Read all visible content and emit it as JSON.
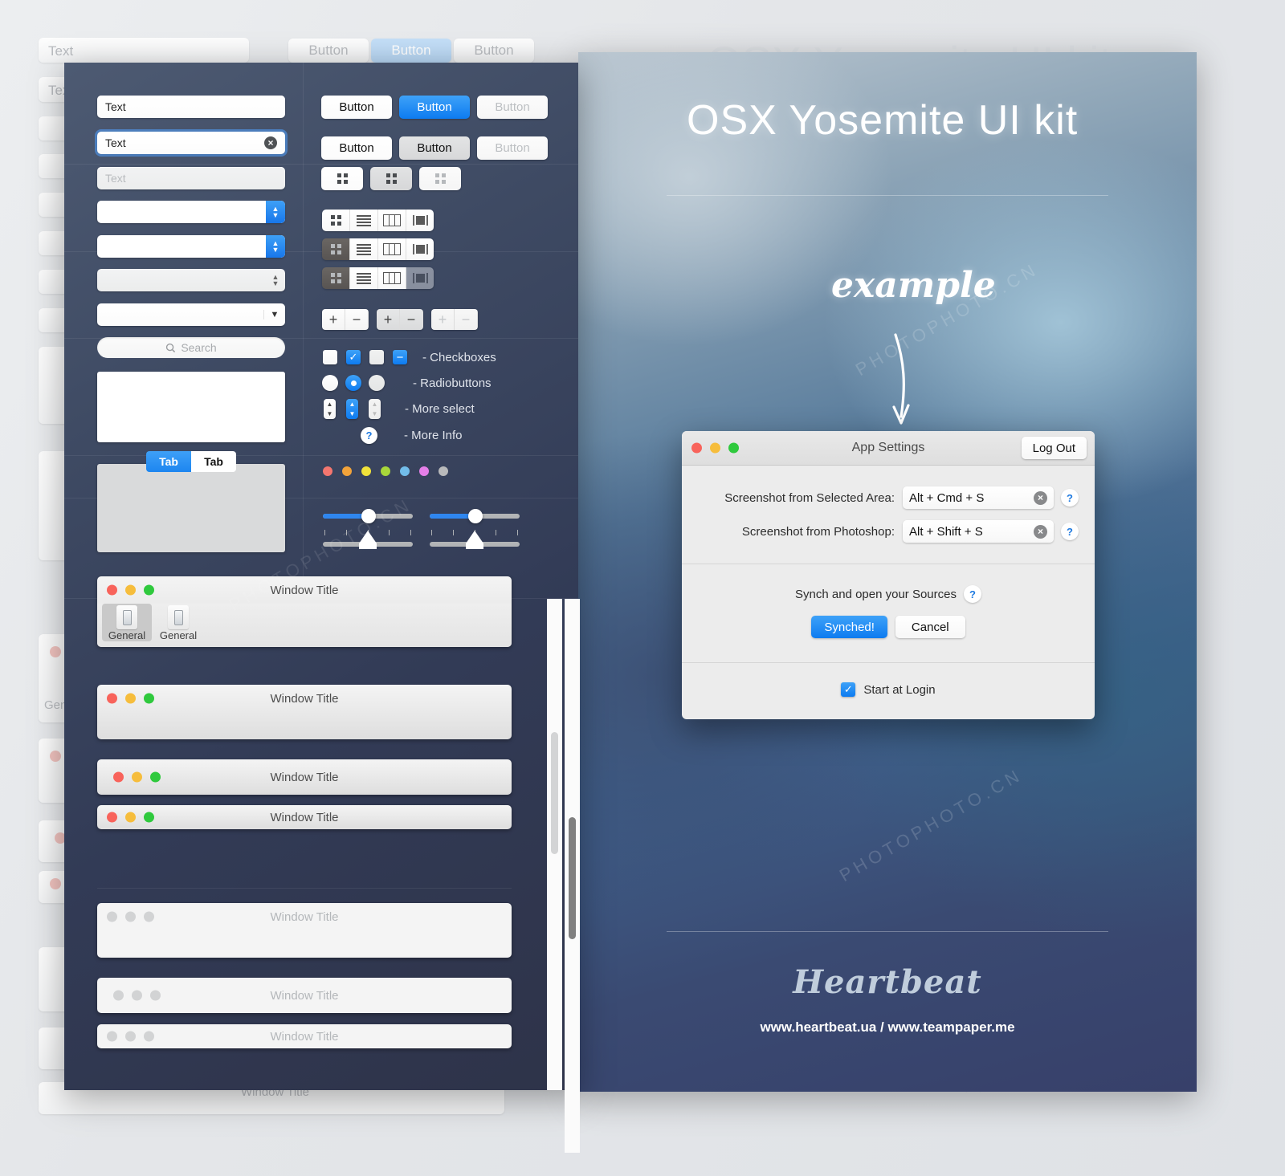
{
  "background": {
    "ghost_text_field": "Text",
    "ghost_buttons": [
      "Button",
      "Button",
      "Button"
    ]
  },
  "kit": {
    "left_column": {
      "text_field_default": "Text",
      "text_field_focused": "Text",
      "text_field_focused_clear_icon": "clear-icon",
      "text_field_disabled": "Text",
      "search_placeholder": "Search",
      "search_icon": "search-icon",
      "tabs": [
        {
          "label": "Tab",
          "state": "active"
        },
        {
          "label": "Tab",
          "state": "inactive"
        }
      ]
    },
    "right_column": {
      "buttons_row1": [
        {
          "label": "Button",
          "state": "default"
        },
        {
          "label": "Button",
          "state": "primary"
        },
        {
          "label": "Button",
          "state": "disabled"
        }
      ],
      "buttons_row2": [
        {
          "label": "Button",
          "state": "default"
        },
        {
          "label": "Button",
          "state": "pressed"
        },
        {
          "label": "Button",
          "state": "disabled"
        }
      ],
      "icon_buttons": [
        "grid-icon",
        "grid-icon",
        "grid-icon"
      ],
      "view_segments": [
        "grid-view-icon",
        "list-view-icon",
        "column-view-icon",
        "coverflow-view-icon"
      ],
      "stepper_labels": [
        "+",
        "−"
      ],
      "control_rows": [
        {
          "label": "- Checkboxes",
          "name": "checkboxes"
        },
        {
          "label": "- Radiobuttons",
          "name": "radiobuttons"
        },
        {
          "label": "- More select",
          "name": "more-select"
        },
        {
          "label": "- More Info",
          "name": "more-info"
        }
      ],
      "more_info_icon": "question-mark-icon",
      "color_swatches": [
        "#f4766f",
        "#f2a33a",
        "#f0e23a",
        "#a8d73a",
        "#72bdea",
        "#e57fe8",
        "#b9babb"
      ],
      "sliders": [
        {
          "fill_percent": 55,
          "ticks": 5
        },
        {
          "fill_percent": 55,
          "ticks": 5
        }
      ]
    },
    "windows": [
      {
        "title": "Window Title",
        "style": "toolbar",
        "lights": "color",
        "toolbar_items": [
          {
            "label": "General",
            "icon": "preferences-icon",
            "selected": true
          },
          {
            "label": "General",
            "icon": "preferences-icon",
            "selected": false
          }
        ]
      },
      {
        "title": "Window Title",
        "style": "tall",
        "lights": "color"
      },
      {
        "title": "Window Title",
        "style": "medium",
        "lights": "color"
      },
      {
        "title": "Window Title",
        "style": "short",
        "lights": "color"
      },
      {
        "title": "Window Title",
        "style": "tall",
        "lights": "grey"
      },
      {
        "title": "Window Title",
        "style": "medium",
        "lights": "grey"
      },
      {
        "title": "Window Title",
        "style": "short",
        "lights": "grey"
      }
    ],
    "traffic_lights": {
      "close": "#f8635b",
      "minimize": "#f6bd3c",
      "zoom": "#2fc93d",
      "inactive": "#d2d3d4"
    },
    "scrollbars": [
      {
        "name": "scrollbar-light",
        "thumb_color": "#d3d4d5"
      },
      {
        "name": "scrollbar-dark",
        "thumb_color": "#808080"
      }
    ]
  },
  "promo": {
    "title": "OSX Yosemite UI kit",
    "example_label": "example",
    "arrow_icon": "down-arrow-icon",
    "logo": "Heartbeat",
    "url": "www.heartbeat.ua / www.teampaper.me"
  },
  "dialog": {
    "title": "App Settings",
    "logout_label": "Log Out",
    "traffic_lights": {
      "close": "#f8635b",
      "minimize": "#f6bd3c",
      "zoom": "#2fc93d"
    },
    "shortcut_rows": [
      {
        "label": "Screenshot from Selected Area:",
        "value": "Alt + Cmd + S",
        "clear_icon": "clear-icon",
        "help_icon": "question-mark-icon"
      },
      {
        "label": "Screenshot from Photoshop:",
        "value": "Alt + Shift + S",
        "clear_icon": "clear-icon",
        "help_icon": "question-mark-icon"
      }
    ],
    "sync": {
      "label": "Synch and open your Sources",
      "help_icon": "question-mark-icon",
      "primary_button": "Synched!",
      "secondary_button": "Cancel"
    },
    "startup": {
      "label": "Start at Login",
      "checked": true
    }
  },
  "watermarks": [
    "PHOTOPHOTO.CN",
    "PHOTOPHOTO.CN",
    "PHOTOPHOTO.CN"
  ]
}
